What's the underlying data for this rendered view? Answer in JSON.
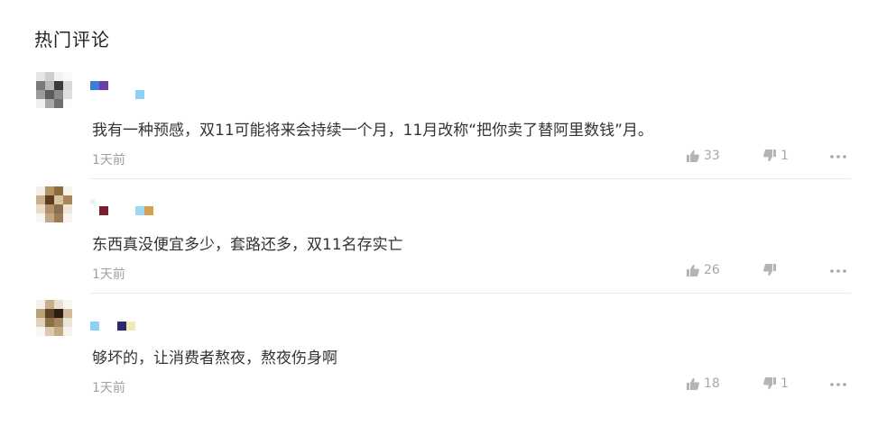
{
  "section": {
    "title": "热门评论"
  },
  "comments": [
    {
      "text": "我有一种预感，双11可能将来会持续一个月，11月改称“把你卖了替阿里数钱”月。",
      "time": "1天前",
      "likes": "33",
      "dislikes": "1"
    },
    {
      "text": "东西真没便宜多少，套路还多，双11名存实亡",
      "time": "1天前",
      "likes": "26",
      "dislikes": ""
    },
    {
      "text": "够坏的，让消费者熬夜，熬夜伤身啊",
      "time": "1天前",
      "likes": "18",
      "dislikes": "1"
    }
  ],
  "icons": {
    "like": "thumbs-up-icon",
    "dislike": "thumbs-down-icon",
    "more": "more-dots-icon"
  },
  "colors": {
    "text": "#333333",
    "meta": "#a0a0a0",
    "icon": "#b4b4b4",
    "divider": "#ececec"
  }
}
